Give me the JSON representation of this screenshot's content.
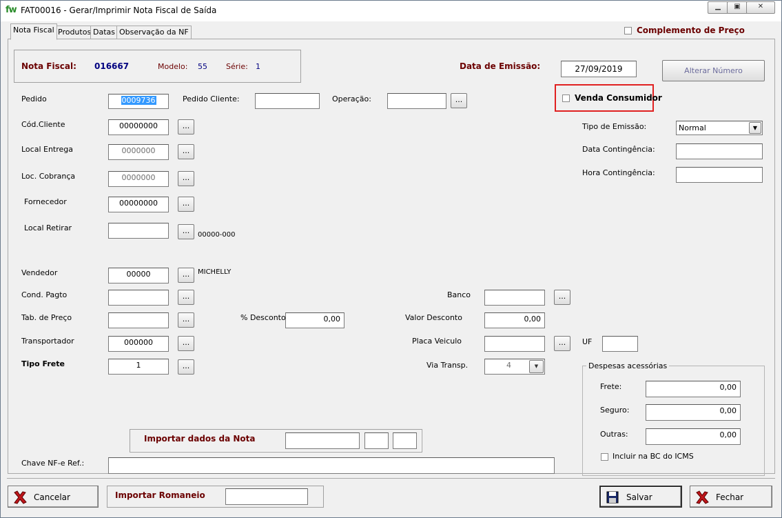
{
  "window": {
    "logo": "fw",
    "title": "FAT00016 - Gerar/Imprimir Nota Fiscal de Saída",
    "minimize": "▁",
    "maximize": "▣",
    "close": "✕"
  },
  "tabs": [
    {
      "label": "Nota Fiscal"
    },
    {
      "label": "Produtos"
    },
    {
      "label": "Datas"
    },
    {
      "label": "Observação da NF"
    }
  ],
  "complemento_preco": {
    "label": "Complemento de Preço",
    "checked": false
  },
  "header": {
    "nota_fiscal_label": "Nota Fiscal:",
    "nota_fiscal_value": "016667",
    "modelo_label": "Modelo:",
    "modelo_value": "55",
    "serie_label": "Série:",
    "serie_value": "1",
    "data_emissao_label": "Data de Emissão:",
    "data_emissao_value": "27/09/2019",
    "alterar_numero": "Alterar Número"
  },
  "venda_consumidor": {
    "label": "Venda Consumidor",
    "checked": false
  },
  "fields": {
    "pedido": {
      "label": "Pedido",
      "value": "0009736"
    },
    "pedido_cliente": {
      "label": "Pedido Cliente:",
      "value": ""
    },
    "operacao": {
      "label": "Operação:",
      "value": ""
    },
    "cod_cliente": {
      "label": "Cód.Cliente",
      "value": "00000000"
    },
    "local_entrega": {
      "label": "Local Entrega",
      "value": "0000000"
    },
    "loc_cobranca": {
      "label": "Loc. Cobrança",
      "value": "0000000"
    },
    "fornecedor": {
      "label": "Fornecedor",
      "value": "00000000"
    },
    "local_retirar": {
      "label": "Local Retirar",
      "value": "",
      "note": "00000-000"
    },
    "vendedor": {
      "label": "Vendedor",
      "value": "00000",
      "note": "MICHELLY"
    },
    "cond_pagto": {
      "label": "Cond. Pagto",
      "value": ""
    },
    "tab_preco": {
      "label": "Tab. de Preço",
      "value": ""
    },
    "transportador": {
      "label": "Transportador",
      "value": "000000"
    },
    "tipo_frete": {
      "label": "Tipo Frete",
      "value": "1"
    },
    "desconto_pct": {
      "label": "% Desconto",
      "value": "0,00"
    },
    "banco": {
      "label": "Banco",
      "value": ""
    },
    "valor_desconto": {
      "label": "Valor Desconto",
      "value": "0,00"
    },
    "placa_veiculo": {
      "label": "Placa Veiculo",
      "value": ""
    },
    "uf": {
      "label": "UF",
      "value": ""
    },
    "via_transp": {
      "label": "Via Transp.",
      "value": "4"
    },
    "tipo_emissao": {
      "label": "Tipo de Emissão:",
      "value": "Normal"
    },
    "data_contingencia": {
      "label": "Data Contingência:",
      "value": ""
    },
    "hora_contingencia": {
      "label": "Hora Contingência:",
      "value": ""
    },
    "chave_nfe": {
      "label": "Chave NF-e Ref.:",
      "value": ""
    }
  },
  "ellipsis": "...",
  "dropdown_arrow": "▼",
  "importar_nota": {
    "label": "Importar dados da Nota",
    "v1": "",
    "v2": "",
    "v3": ""
  },
  "despesas": {
    "title": "Despesas acessórias",
    "frete_label": "Frete:",
    "frete_value": "0,00",
    "seguro_label": "Seguro:",
    "seguro_value": "0,00",
    "outras_label": "Outras:",
    "outras_value": "0,00",
    "incluir_label": "Incluir na BC do ICMS",
    "incluir_checked": false
  },
  "footer": {
    "cancelar": "Cancelar",
    "importar_romaneio": "Importar Romaneio",
    "romaneio_value": "",
    "salvar": "Salvar",
    "fechar": "Fechar"
  },
  "colors": {
    "accent_red": "#e02020",
    "label_maroon": "#6b0000",
    "value_blue": "#000080"
  }
}
